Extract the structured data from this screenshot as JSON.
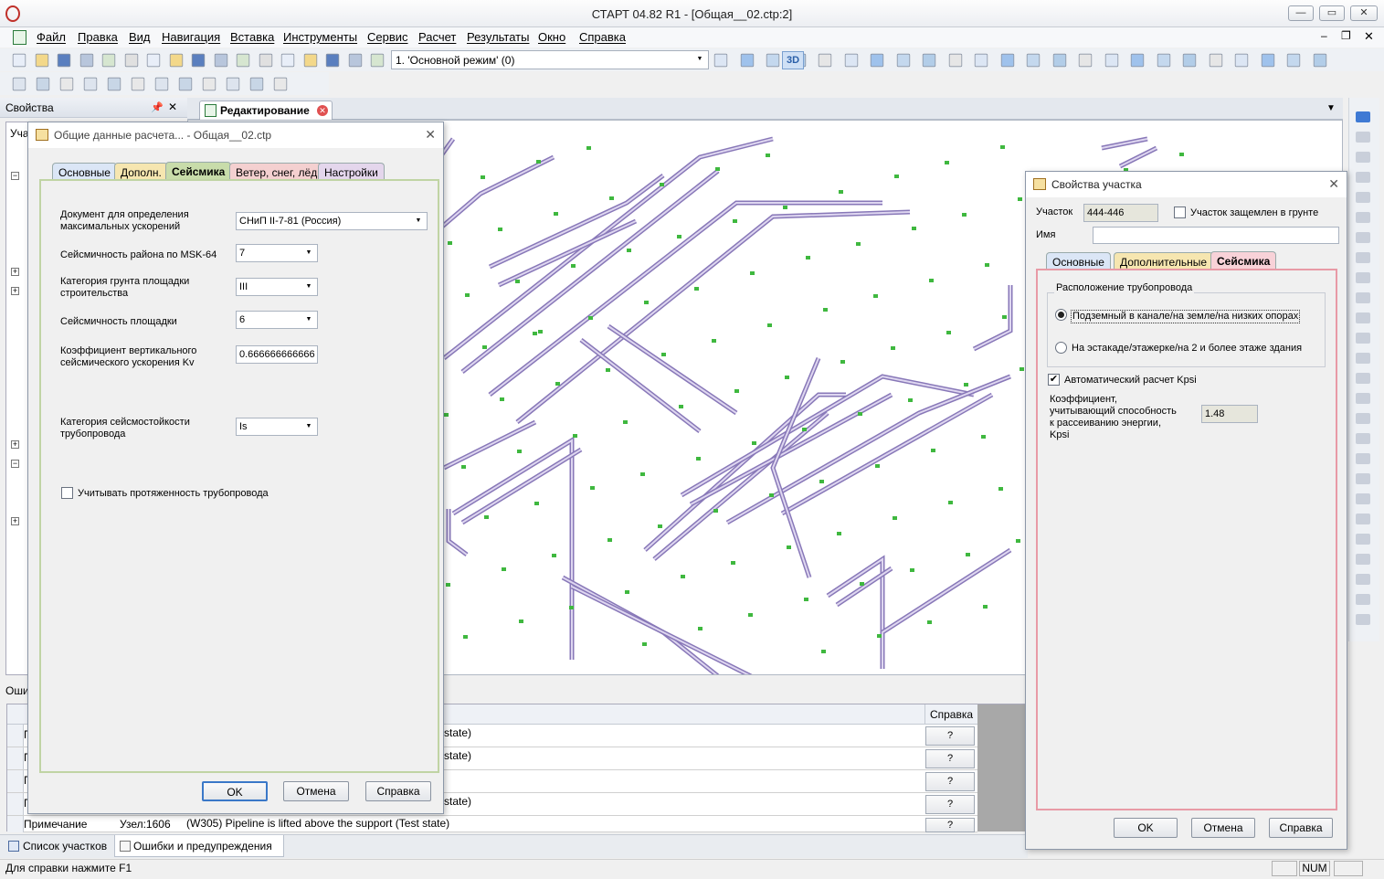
{
  "app": {
    "title": "СТАРТ 04.82 R1 - [Общая__02.ctp:2]"
  },
  "menu": [
    "Файл",
    "Правка",
    "Вид",
    "Навигация",
    "Вставка",
    "Инструменты",
    "Сервис",
    "Расчет",
    "Результаты",
    "Окно",
    "Справка"
  ],
  "toolbar": {
    "mode_select": "1. 'Основной режим' (0)",
    "view3d": "3D"
  },
  "properties_panel": {
    "title": "Свойства",
    "tab_stub": "Уча"
  },
  "editor_tab": {
    "label": "Редактирование"
  },
  "general_dialog": {
    "title": "Общие данные расчета... - Общая__02.ctp",
    "tabs": [
      "Основные",
      "Дополн.",
      "Сейсмика",
      "Ветер, снег, лёд",
      "Настройки"
    ],
    "active_tab": "Сейсмика",
    "fields": {
      "doc_label": "Документ для определения максимальных ускорений",
      "doc_value": "СНиП II-7-81 (Россия)",
      "msk_label": "Сейсмичность района по MSK-64",
      "msk_value": "7",
      "soil_label": "Категория грунта площадки строительства",
      "soil_value": "III",
      "site_label": "Сейсмичность площадки",
      "site_value": "6",
      "kv_label": "Коэффициент вертикального сейсмического ускорения  Kv",
      "kv_value": "0.666666666666",
      "cat_label": "Категория сейсмостойкости трубопровода",
      "cat_value": "Is",
      "length_label": "Учитывать протяженность трубопровода"
    },
    "buttons": {
      "ok": "OK",
      "cancel": "Отмена",
      "help": "Справка"
    }
  },
  "section_dialog": {
    "title": "Свойства участка",
    "section_label": "Участок",
    "section_value": "444-446",
    "ground_label": "Участок защемлен в грунте",
    "name_label": "Имя",
    "name_value": "",
    "tabs": [
      "Основные",
      "Дополнительные",
      "Сейсмика"
    ],
    "active_tab": "Сейсмика",
    "group_title": "Расположение трубопровода",
    "radio1": "Подземный в канале/на земле/на низких опорах",
    "radio2": "На эстакаде/этажерке/на 2 и более этаже здания",
    "auto_label": "Автоматический расчет Kpsi",
    "coef_label": "Коэффициент, учитывающий способность к рассеиванию энергии, Kpsi",
    "coef_value": "1.48",
    "buttons": {
      "ok": "OK",
      "cancel": "Отмена",
      "help": "Справка"
    }
  },
  "errors_panel": {
    "header_stub": "Оши",
    "help_header": "Справка",
    "rows": [
      {
        "type": "П",
        "node": "",
        "msg": "state)"
      },
      {
        "type": "П",
        "node": "",
        "msg": "state)"
      },
      {
        "type": "П",
        "node": "",
        "msg": ""
      },
      {
        "type": "П",
        "node": "",
        "msg": "state)"
      },
      {
        "type": "Примечание",
        "node": "Узел:1606",
        "msg": "(W305) Pipeline is lifted above the support (Test state)"
      }
    ],
    "help_btn": "?"
  },
  "bottom_tabs": [
    "Список участков",
    "Ошибки и предупреждения"
  ],
  "status": {
    "hint": "Для справки нажмите F1",
    "num": "NUM"
  },
  "colors": {
    "pipe": "#8878b8",
    "support": "#3fb83f",
    "accent": "#3070c8",
    "tab_seismic": "#c8e0a8"
  }
}
